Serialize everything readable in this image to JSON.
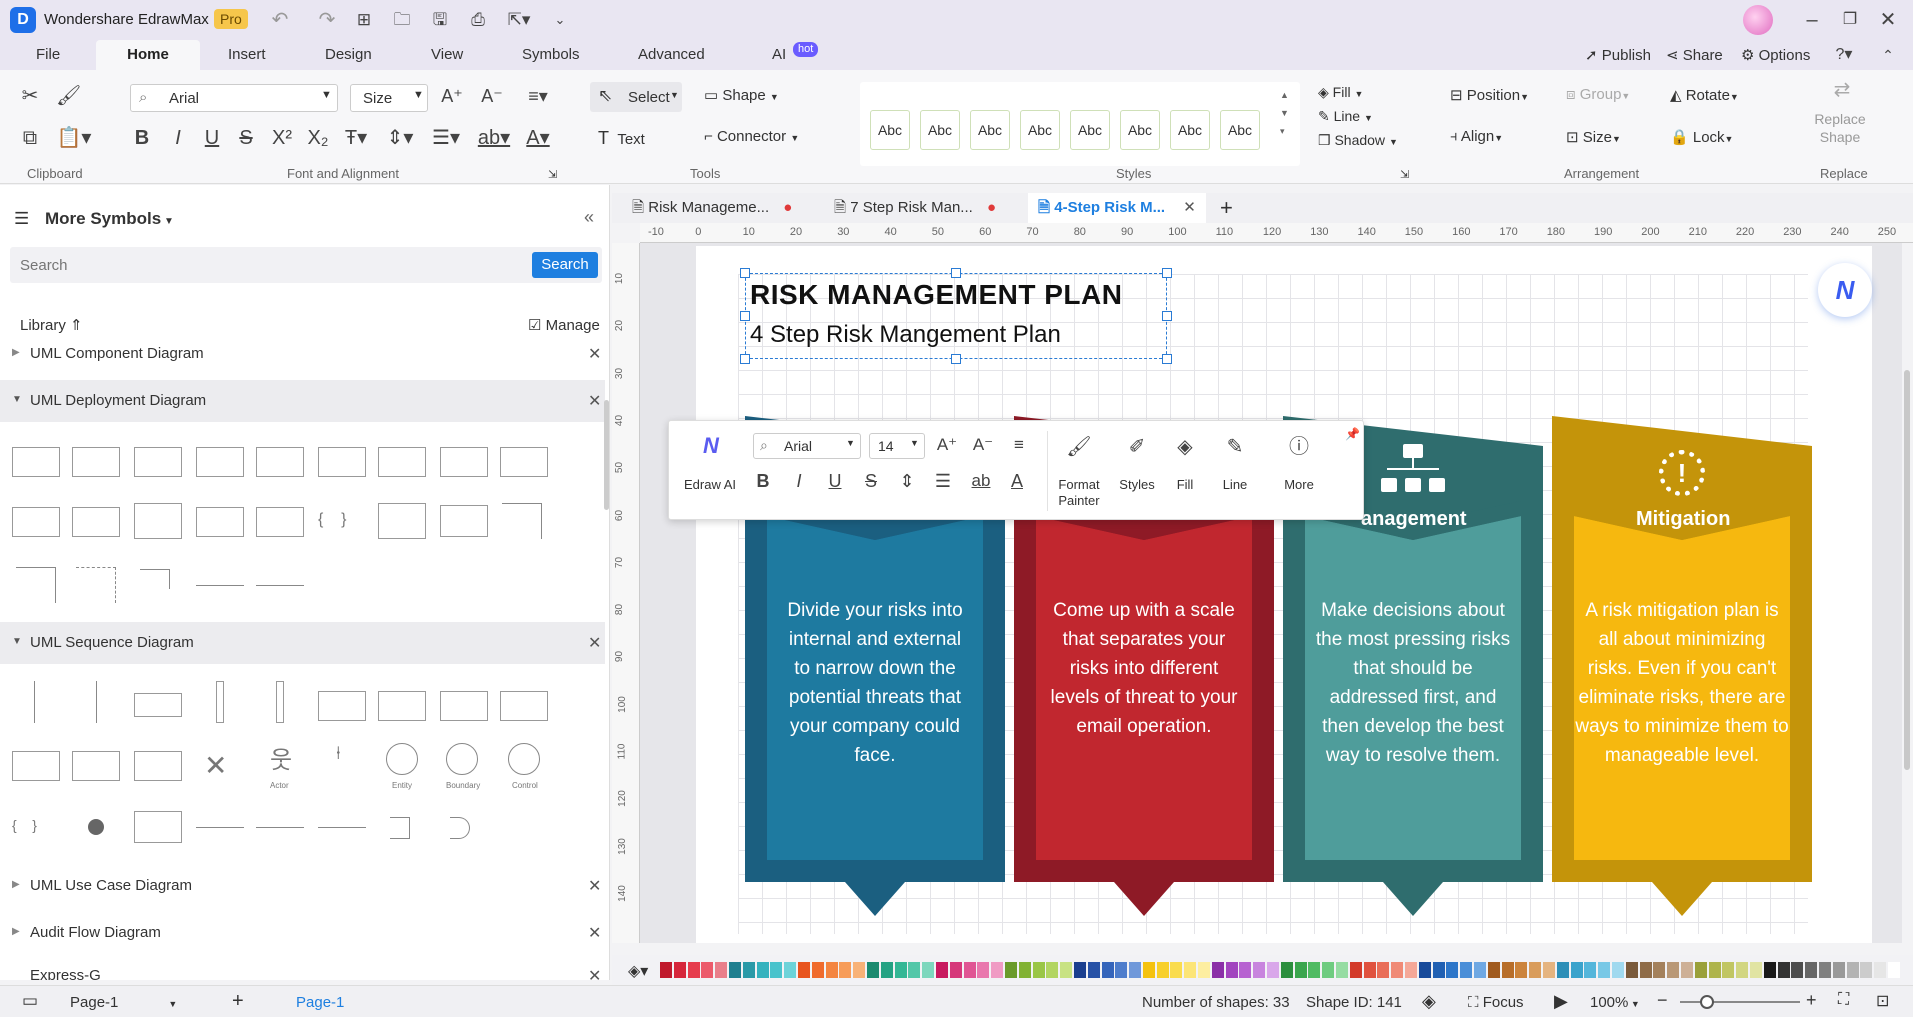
{
  "app": {
    "title": "Wondershare EdrawMax",
    "badge": "Pro"
  },
  "menu": {
    "tabs": [
      "File",
      "Home",
      "Insert",
      "Design",
      "View",
      "Symbols",
      "Advanced",
      "AI"
    ],
    "ai_badge": "hot",
    "active": "Home",
    "right": {
      "publish": "Publish",
      "share": "Share",
      "options": "Options"
    }
  },
  "ribbon": {
    "font": "Arial",
    "size": "Size",
    "select": "Select",
    "shape": "Shape",
    "text": "Text",
    "connector": "Connector",
    "style_sample": "Abc",
    "fill": "Fill",
    "line": "Line",
    "shadow": "Shadow",
    "position": "Position",
    "group": "Group",
    "rotate": "Rotate",
    "align": "Align",
    "lock": "Lock",
    "replace_shape": "Replace Shape",
    "groups": {
      "clipboard": "Clipboard",
      "font": "Font and Alignment",
      "tools": "Tools",
      "styles": "Styles",
      "arrangement": "Arrangement",
      "replace": "Replace"
    }
  },
  "sidebar": {
    "title": "More Symbols",
    "search_placeholder": "Search",
    "search_button": "Search",
    "library": "Library",
    "manage": "Manage",
    "sections": [
      "UML Component Diagram",
      "UML Deployment Diagram",
      "UML Sequence Diagram",
      "UML Use Case Diagram",
      "Audit Flow Diagram",
      "Express-G"
    ],
    "shape_labels": {
      "actor": "Actor",
      "entity": "Entity",
      "boundary": "Boundary",
      "control": "Control"
    }
  },
  "doc_tabs": [
    "Risk Manageme...",
    "7 Step Risk Man...",
    "4-Step Risk M..."
  ],
  "ruler": {
    "h": [
      "-10",
      "0",
      "10",
      "20",
      "30",
      "40",
      "50",
      "60",
      "70",
      "80",
      "90",
      "100",
      "110",
      "120",
      "130",
      "140",
      "150",
      "160",
      "170",
      "180",
      "190",
      "200",
      "210",
      "220",
      "230",
      "240",
      "250"
    ],
    "v": [
      "10",
      "20",
      "30",
      "40",
      "50",
      "60",
      "70",
      "80",
      "90",
      "100",
      "110",
      "120",
      "130",
      "140"
    ]
  },
  "diagram": {
    "title": "RISK MANAGEMENT PLAN",
    "subtitle": "4 Step Risk Mangement Plan",
    "columns": [
      {
        "heading": "",
        "text": "Divide your risks into internal and external to narrow down the potential threats that your company could face.",
        "color_dark": "#1b5f80",
        "color_main": "#1e7aa0"
      },
      {
        "heading": "",
        "text": "Come up with a scale that separates your risks into different levels of threat to your email operation.",
        "color_dark": "#8e1a26",
        "color_main": "#c1272f"
      },
      {
        "heading": "anagement",
        "text": "Make decisions about the most pressing risks that should be addressed first, and then develop the best way to resolve them.",
        "color_dark": "#2f6d6e",
        "color_main": "#4f9d9b"
      },
      {
        "heading": "Mitigation",
        "text": "A risk mitigation plan is all about minimizing risks. Even if you can't eliminate risks, there are ways to minimize them to manageable level.",
        "color_dark": "#c4940a",
        "color_main": "#f6b80f"
      }
    ]
  },
  "float_toolbar": {
    "ai": "Edraw AI",
    "font": "Arial",
    "size": "14",
    "format_painter": "Format Painter",
    "styles": "Styles",
    "fill": "Fill",
    "line": "Line",
    "more": "More"
  },
  "status": {
    "page_sel": "Page-1",
    "page_tab": "Page-1",
    "shapes": "Number of shapes: 33",
    "shape_id": "Shape ID: 141",
    "focus": "Focus",
    "zoom": "100%"
  },
  "palette": [
    "#c0192c",
    "#d6263b",
    "#e63c4d",
    "#ec5a6b",
    "#e97e8a",
    "#1f7f8f",
    "#2a9aa8",
    "#34b2be",
    "#49c3cc",
    "#6dd3d9",
    "#e8541e",
    "#f06b2c",
    "#f4843f",
    "#f79c58",
    "#f8b277",
    "#1b8a6f",
    "#24a283",
    "#33b795",
    "#52c7a8",
    "#7dd7bd",
    "#c8195f",
    "#d6377a",
    "#e05594",
    "#e977ad",
    "#f09bc4",
    "#6a9b2a",
    "#82b234",
    "#9ac646",
    "#b2d561",
    "#c8e283",
    "#1a3f8f",
    "#2751a6",
    "#3565bb",
    "#4e7dcc",
    "#6f98da",
    "#f5c20f",
    "#f8d02b",
    "#fadc4e",
    "#fce577",
    "#fdeea0",
    "#8b2fa8",
    "#a244bf",
    "#b762d1",
    "#c884de",
    "#d9a7ea",
    "#2c8f3e",
    "#3aa64d",
    "#4fbb62",
    "#6fcc80",
    "#95dca2",
    "#d33a2a",
    "#e0523f",
    "#e96d58",
    "#f08a76",
    "#f5a898",
    "#174a9a",
    "#2060b3",
    "#2d76c9",
    "#4a8ed8",
    "#6fa8e3",
    "#a05a1e",
    "#b86e2a",
    "#cc843c",
    "#d99c5b",
    "#e5b480",
    "#2d8fb8",
    "#3aa3cc",
    "#54b6db",
    "#78c8e6",
    "#a0d9ef",
    "#7a5a3a",
    "#8f6c48",
    "#a4815c",
    "#b99876",
    "#ceb096",
    "#9aa03a",
    "#aeb44c",
    "#c1c663",
    "#d2d681",
    "#e1e4a3",
    "#1a1a1a",
    "#333333",
    "#4d4d4d",
    "#666666",
    "#808080",
    "#999999",
    "#b3b3b3",
    "#cccccc",
    "#e6e6e6",
    "#ffffff"
  ]
}
